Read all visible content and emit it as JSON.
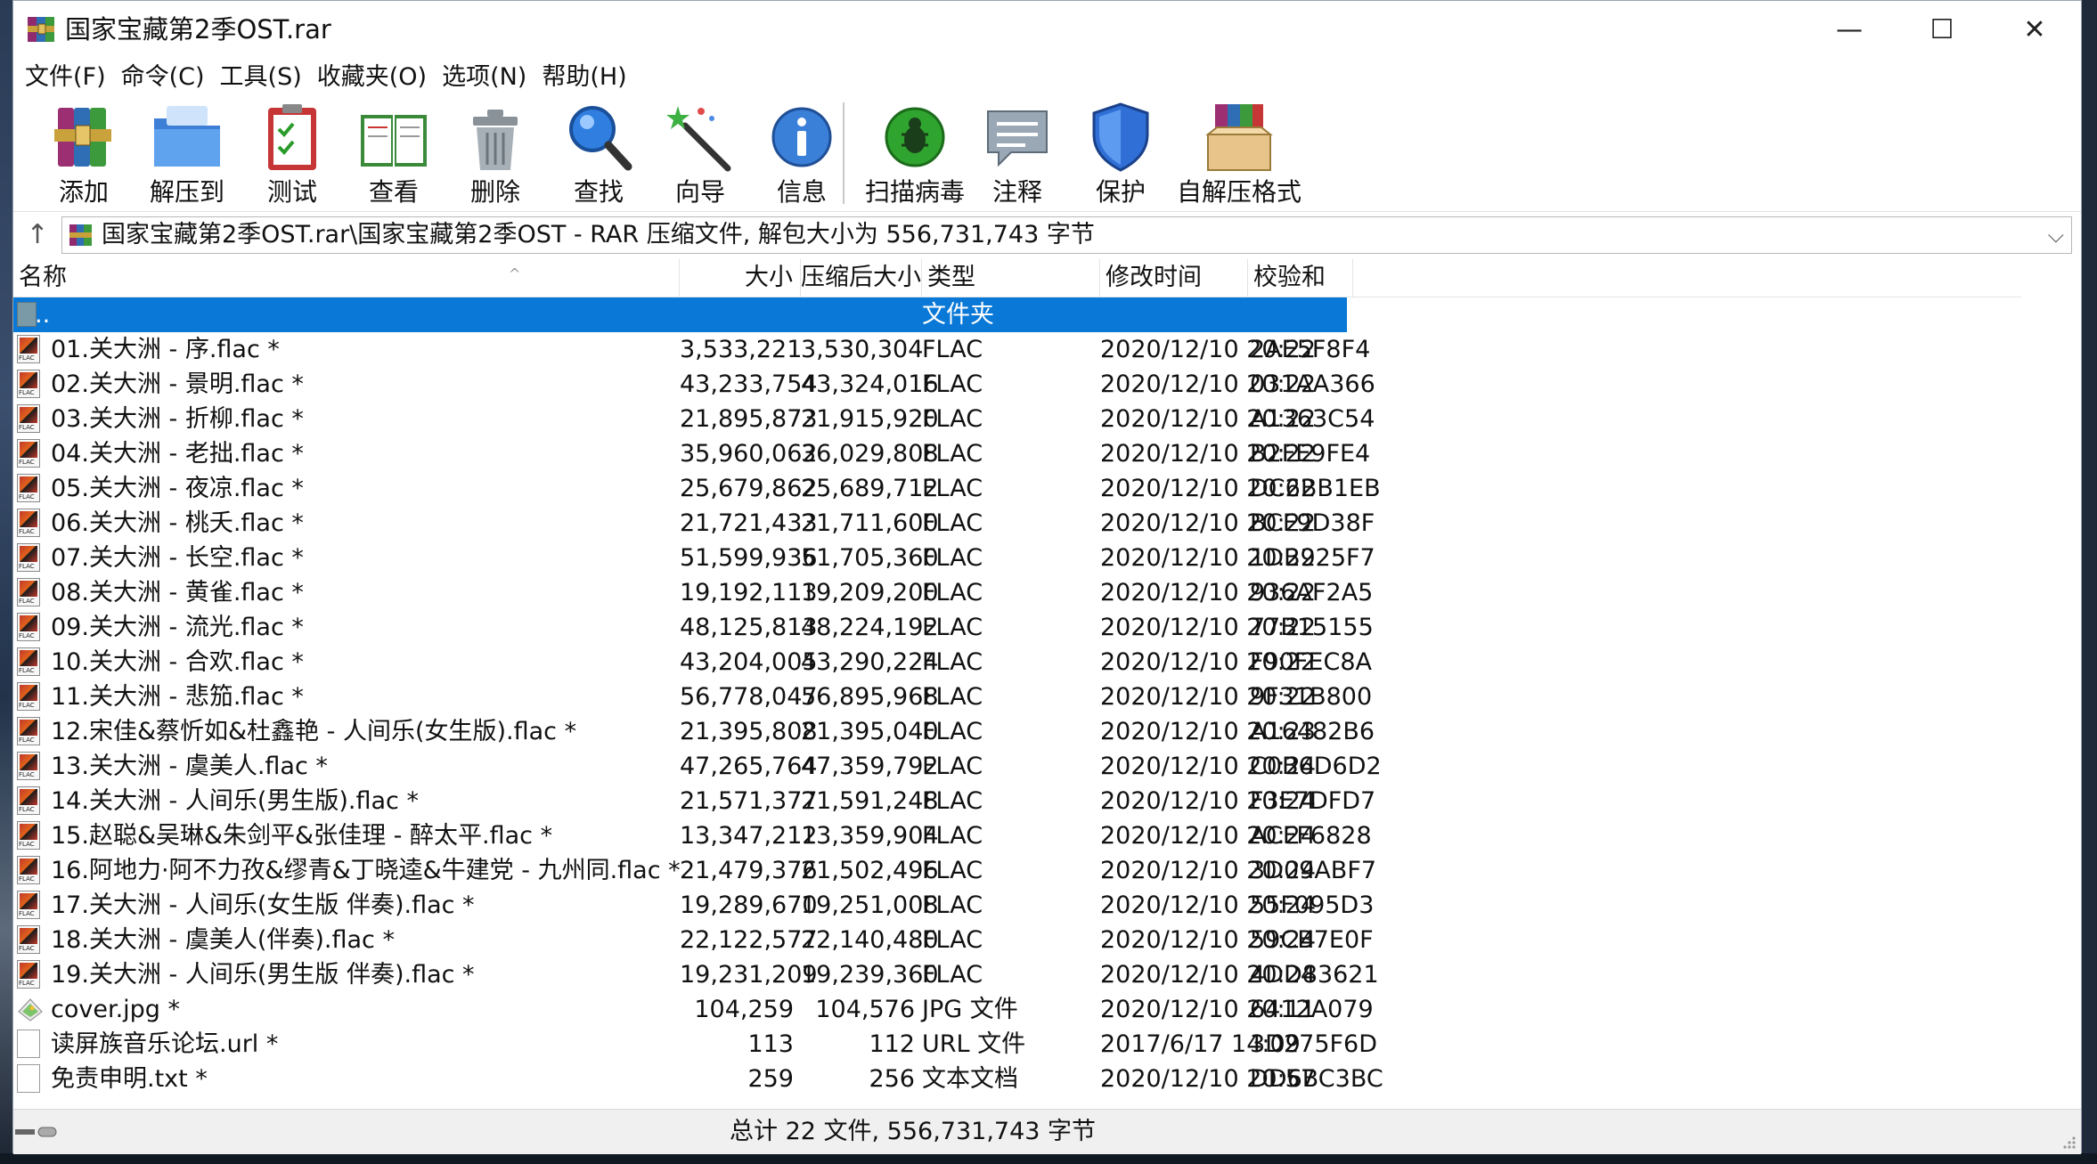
{
  "window": {
    "title": "国家宝藏第2季OST.rar",
    "minimize_glyph": "—",
    "maximize_glyph": "☐",
    "close_glyph": "✕"
  },
  "menu": [
    "文件(F)",
    "命令(C)",
    "工具(S)",
    "收藏夹(O)",
    "选项(N)",
    "帮助(H)"
  ],
  "toolbar": [
    {
      "label": "添加",
      "icon": "add-archive-icon"
    },
    {
      "label": "解压到",
      "icon": "extract-folder-icon"
    },
    {
      "label": "测试",
      "icon": "test-clipboard-icon"
    },
    {
      "label": "查看",
      "icon": "view-book-icon"
    },
    {
      "label": "删除",
      "icon": "trash-icon"
    },
    {
      "label": "查找",
      "icon": "magnifier-icon"
    },
    {
      "label": "向导",
      "icon": "wizard-wand-icon"
    },
    {
      "label": "信息",
      "icon": "info-icon"
    },
    {
      "label": "扫描病毒",
      "icon": "virus-scan-icon"
    },
    {
      "label": "注释",
      "icon": "comment-icon"
    },
    {
      "label": "保护",
      "icon": "shield-icon"
    },
    {
      "label": "自解压格式",
      "icon": "sfx-box-icon"
    }
  ],
  "address": {
    "text": "国家宝藏第2季OST.rar\\国家宝藏第2季OST - RAR 压缩文件, 解包大小为 556,731,743 字节",
    "up_glyph": "↑",
    "dropdown_glyph": "⌵"
  },
  "columns": {
    "name": "名称",
    "size": "大小",
    "packed": "压缩后大小",
    "type": "类型",
    "modified": "修改时间",
    "crc": "校验和",
    "sort_glyph": "^"
  },
  "parent_row": {
    "name": "..",
    "type": "文件夹"
  },
  "files": [
    {
      "name": "01.关大洲 - 序.flac *",
      "size": "3,533,221",
      "packed": "3,530,304",
      "type": "FLAC",
      "modified": "2020/12/10 20:22",
      "crc": "2AE5F8F4",
      "icon": "flac"
    },
    {
      "name": "02.关大洲 - 景明.flac *",
      "size": "43,233,754",
      "packed": "43,324,016",
      "type": "FLAC",
      "modified": "2020/12/10 20:22",
      "crc": "031AA366",
      "icon": "flac"
    },
    {
      "name": "03.关大洲 - 折柳.flac *",
      "size": "21,895,873",
      "packed": "21,915,920",
      "type": "FLAC",
      "modified": "2020/12/10 20:22",
      "crc": "A1363C54",
      "icon": "flac"
    },
    {
      "name": "04.关大洲 - 老拙.flac *",
      "size": "35,960,062",
      "packed": "36,029,808",
      "type": "FLAC",
      "modified": "2020/12/10 20:22",
      "crc": "B2FE9FE4",
      "icon": "flac"
    },
    {
      "name": "05.关大洲 - 夜凉.flac *",
      "size": "25,679,862",
      "packed": "25,689,712",
      "type": "FLAC",
      "modified": "2020/12/10 20:22",
      "crc": "DC6BB1EB",
      "icon": "flac"
    },
    {
      "name": "06.关大洲 - 桃夭.flac *",
      "size": "21,721,433",
      "packed": "21,711,600",
      "type": "FLAC",
      "modified": "2020/12/10 20:22",
      "crc": "BCF9D38F",
      "icon": "flac"
    },
    {
      "name": "07.关大洲 - 长空.flac *",
      "size": "51,599,936",
      "packed": "51,705,360",
      "type": "FLAC",
      "modified": "2020/12/10 20:22",
      "crc": "1DB925F7",
      "icon": "flac"
    },
    {
      "name": "08.关大洲 - 黄雀.flac *",
      "size": "19,192,113",
      "packed": "19,209,200",
      "type": "FLAC",
      "modified": "2020/12/10 20:22",
      "crc": "936AF2A5",
      "icon": "flac"
    },
    {
      "name": "09.关大洲 - 流光.flac *",
      "size": "48,125,813",
      "packed": "48,224,192",
      "type": "FLAC",
      "modified": "2020/12/10 20:22",
      "crc": "77B15155",
      "icon": "flac"
    },
    {
      "name": "10.关大洲 - 合欢.flac *",
      "size": "43,204,005",
      "packed": "43,290,224",
      "type": "FLAC",
      "modified": "2020/12/10 20:22",
      "crc": "F90FEC8A",
      "icon": "flac"
    },
    {
      "name": "11.关大洲 - 悲笳.flac *",
      "size": "56,778,047",
      "packed": "56,895,968",
      "type": "FLAC",
      "modified": "2020/12/10 20:22",
      "crc": "9F31B800",
      "icon": "flac"
    },
    {
      "name": "12.宋佳&蔡忻如&杜鑫艳 - 人间乐(女生版).flac *",
      "size": "21,395,808",
      "packed": "21,395,040",
      "type": "FLAC",
      "modified": "2020/12/10 20:23",
      "crc": "A16482B6",
      "icon": "flac"
    },
    {
      "name": "13.关大洲 - 虞美人.flac *",
      "size": "47,265,764",
      "packed": "47,359,792",
      "type": "FLAC",
      "modified": "2020/12/10 20:24",
      "crc": "C0B6D6D2",
      "icon": "flac"
    },
    {
      "name": "14.关大洲 - 人间乐(男生版).flac *",
      "size": "21,571,377",
      "packed": "21,591,248",
      "type": "FLAC",
      "modified": "2020/12/10 20:24",
      "crc": "F3E7DFD7",
      "icon": "flac"
    },
    {
      "name": "15.赵聪&吴琳&朱剑平&张佳理 - 醉太平.flac *",
      "size": "13,347,212",
      "packed": "13,359,904",
      "type": "FLAC",
      "modified": "2020/12/10 20:24",
      "crc": "ACFF6828",
      "icon": "flac"
    },
    {
      "name": "16.阿地力·阿不力孜&缪青&丁晓逵&牛建党 - 九州同.flac *",
      "size": "21,479,376",
      "packed": "21,502,496",
      "type": "FLAC",
      "modified": "2020/12/10 20:24",
      "crc": "3D09ABF7",
      "icon": "flac"
    },
    {
      "name": "17.关大洲 - 人间乐(女生版 伴奏).flac *",
      "size": "19,289,670",
      "packed": "19,251,008",
      "type": "FLAC",
      "modified": "2020/12/10 20:24",
      "crc": "55F095D3",
      "icon": "flac"
    },
    {
      "name": "18.关大洲 - 虞美人(伴奏).flac *",
      "size": "22,122,577",
      "packed": "22,140,480",
      "type": "FLAC",
      "modified": "2020/12/10 20:24",
      "crc": "59CB7E0F",
      "icon": "flac"
    },
    {
      "name": "19.关大洲 - 人间乐(男生版 伴奏).flac *",
      "size": "19,231,209",
      "packed": "19,239,360",
      "type": "FLAC",
      "modified": "2020/12/10 20:24",
      "crc": "4DD83621",
      "icon": "flac"
    },
    {
      "name": "cover.jpg *",
      "size": "104,259",
      "packed": "104,576",
      "type": "JPG 文件",
      "modified": "2020/12/10 20:11",
      "crc": "6412A079",
      "icon": "image"
    },
    {
      "name": "读屏族音乐论坛.url *",
      "size": "113",
      "packed": "112",
      "type": "URL 文件",
      "modified": "2017/6/17 14:09",
      "crc": "3D275F6D",
      "icon": "url"
    },
    {
      "name": "免责申明.txt *",
      "size": "259",
      "packed": "256",
      "type": "文本文档",
      "modified": "2020/12/10 20:57",
      "crc": "DD6BC3BC",
      "icon": "text"
    }
  ],
  "status": {
    "text": "总计 22 文件, 556,731,743 字节"
  },
  "colors": {
    "selection": "#0a78d7",
    "window_bg": "#ffffff",
    "status_bg": "#f0f0f0"
  }
}
